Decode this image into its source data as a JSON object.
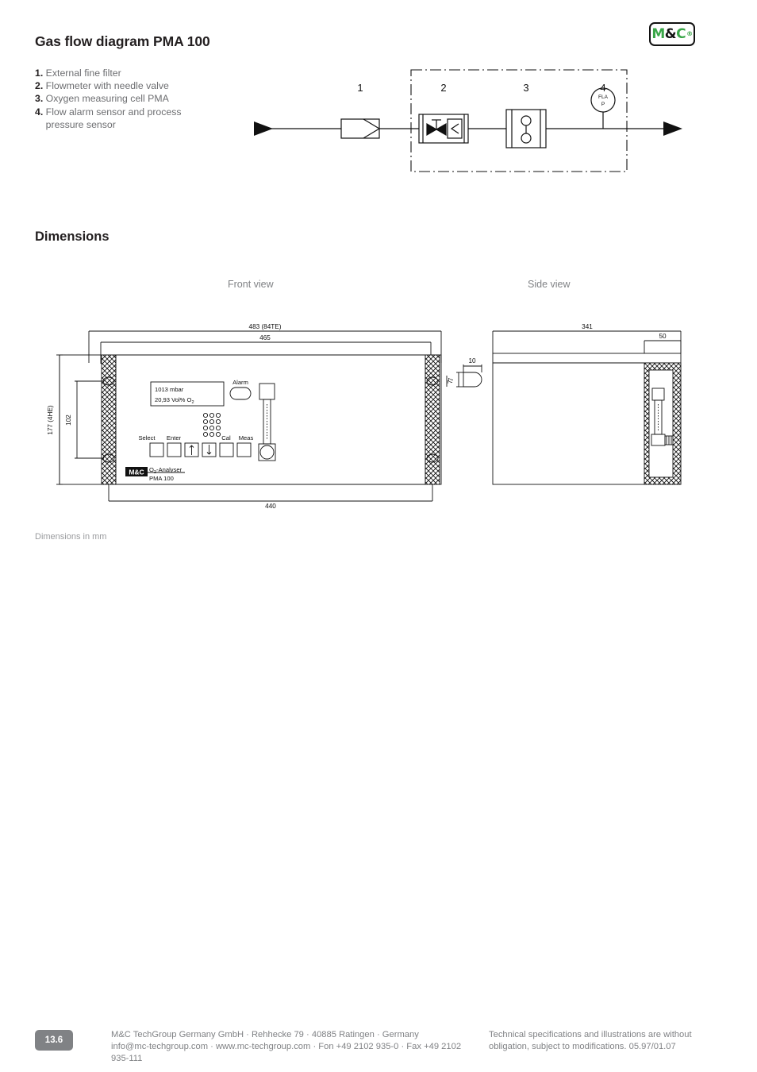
{
  "logo": {
    "name": "mc-logo",
    "part1": "M",
    "amp": "&",
    "part2": "C",
    "registered": "®",
    "green": "#3aa648",
    "black": "#111111"
  },
  "header": {
    "title": "Gas flow diagram  PMA 100"
  },
  "legend": {
    "items": [
      {
        "num": "1.",
        "text": " External fine filter"
      },
      {
        "num": "2.",
        "text": " Flowmeter with needle valve"
      },
      {
        "num": "3.",
        "text": " Oxygen measuring cell PMA"
      },
      {
        "num": "4.",
        "text": " Flow alarm sensor and process\n    pressure sensor"
      }
    ]
  },
  "flow_diagram": {
    "callouts": [
      "1",
      "2",
      "3",
      "4"
    ],
    "sensor_line1": "FLA",
    "sensor_line2": "P"
  },
  "dimensions_section": {
    "heading": "Dimensions",
    "front_view_label": "Front view",
    "side_view_label": "Side view",
    "note": "Dimensions in mm"
  },
  "front_view": {
    "dim_top_outer": "483 (84TE)",
    "dim_top_inner": "465",
    "dim_bottom": "440",
    "dim_left_outer": "177 (4HE)",
    "dim_left_inner": "102",
    "dim_right": "7",
    "display_line1": "1013 mbar",
    "display_line2_a": "20,93 Vol% O",
    "display_line2_sub": "2",
    "alarm_label": "Alarm",
    "buttons": [
      "Select",
      "Enter",
      "Cal",
      "Meas"
    ],
    "badge_text_a": "M",
    "badge_text_b": "&",
    "badge_text_c": "C",
    "nameplate_line1_a": "O",
    "nameplate_line1_sub": "2",
    "nameplate_line1_b": "-Analyser",
    "nameplate_line2": "PMA 100"
  },
  "side_view": {
    "dim_depth": "341",
    "dim_panel": "50",
    "dim_slot_w": "10",
    "dim_slot_h": "7"
  },
  "footer": {
    "page": "13.6",
    "company_line1": "M&C TechGroup Germany GmbH · Rehhecke 79 · 40885 Ratingen · Germany",
    "company_line2": "info@mc-techgroup.com · www.mc-techgroup.com · Fon +49 2102 935-0 · Fax +49 2102 935-111",
    "legal_line1": "Technical specifications and illustrations are without",
    "legal_line2": "obligation, subject to modifications. 05.97/01.07"
  }
}
